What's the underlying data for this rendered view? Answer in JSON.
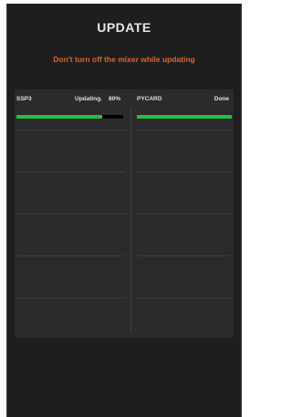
{
  "header": {
    "title": "UPDATE",
    "warning": "Don't turn off the mixer while updating"
  },
  "devices": [
    {
      "name": "SSP3",
      "status": "Updating.",
      "percent": "80%",
      "progress": 0.8
    },
    {
      "name": "PYCARD",
      "status": "Done",
      "percent": "",
      "progress": 1.0
    }
  ],
  "colors": {
    "accent_warning": "#e0642a",
    "progress_fill": "#1fbf4a",
    "background": "#1e1e1e",
    "panel": "#2b2b2b"
  }
}
